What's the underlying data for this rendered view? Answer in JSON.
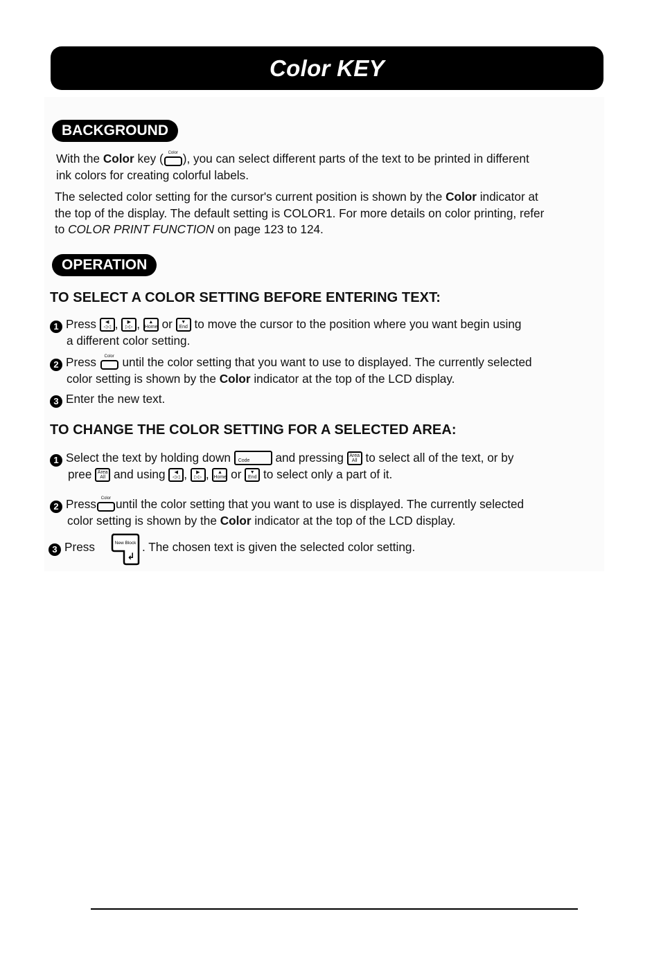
{
  "title": "Color KEY",
  "background": {
    "heading": "BACKGROUND",
    "p1": {
      "pre": "With the ",
      "bold": "Color",
      "mid": " key (",
      "key_label": "Color",
      "post": "), you can select different parts of the text to be printed in different",
      "line2": "ink colors for creating colorful labels."
    },
    "p2": {
      "pre": "The selected color setting for the cursor's current position is shown by the ",
      "bold": "Color",
      "post": " indicator at",
      "line2": "the top of the display.  The default setting is COLOR1. For more details on color printing, refer",
      "line3_pre": "to ",
      "line3_italic": "COLOR PRINT FUNCTION",
      "line3_post": " on page 123 to 124."
    }
  },
  "operation": {
    "heading": "OPERATION",
    "section1": {
      "heading": "TO SELECT A COLOR SETTING BEFORE ENTERING TEXT:",
      "steps": [
        {
          "num": "1",
          "pre": "Press ",
          "sep1": ", ",
          "sep2": ", ",
          "sep3": " or ",
          "post": " to move the cursor to the position where you want begin using",
          "line2": "a different color setting."
        },
        {
          "num": "2",
          "pre": "Press ",
          "post": " until the color setting that you want to use to displayed.  The currently selected",
          "line2_pre": "color setting is shown by the ",
          "line2_bold": "Color",
          "line2_post": " indicator at the top of the LCD display."
        },
        {
          "num": "3",
          "text": "Enter the new text."
        }
      ]
    },
    "section2": {
      "heading": "TO CHANGE THE COLOR SETTING FOR A SELECTED AREA:",
      "steps": [
        {
          "num": "1",
          "pre": "Select the text by holding down ",
          "mid": " and pressing ",
          "post": " to select all of the text, or by",
          "line2_pre": "pree ",
          "line2_mid": " and using ",
          "sep1": ", ",
          "sep2": ", ",
          "sep3": " or ",
          "line2_post": " to select only a part of it."
        },
        {
          "num": "2",
          "pre": "Press",
          "post": "until the color setting that you want to use is displayed.  The currently selected",
          "line2_pre": "color setting is shown by the ",
          "line2_bold": "Color",
          "line2_post": " indicator at the top of the LCD display."
        },
        {
          "num": "3",
          "pre": "Press",
          "post": ".  The chosen text is given the selected color setting."
        }
      ]
    }
  },
  "keys": {
    "color": "Color",
    "left_top": "◀",
    "left_bot": "◁◁",
    "right_top": "▶",
    "right_bot": "▷▷",
    "home_top": "▲",
    "home_bot": "Home",
    "end_top": "▼",
    "end_bot": "End",
    "code": "Code",
    "area_top": "Area",
    "area_bot": "All",
    "enter_label": "New Block",
    "enter_glyph": "↲"
  }
}
